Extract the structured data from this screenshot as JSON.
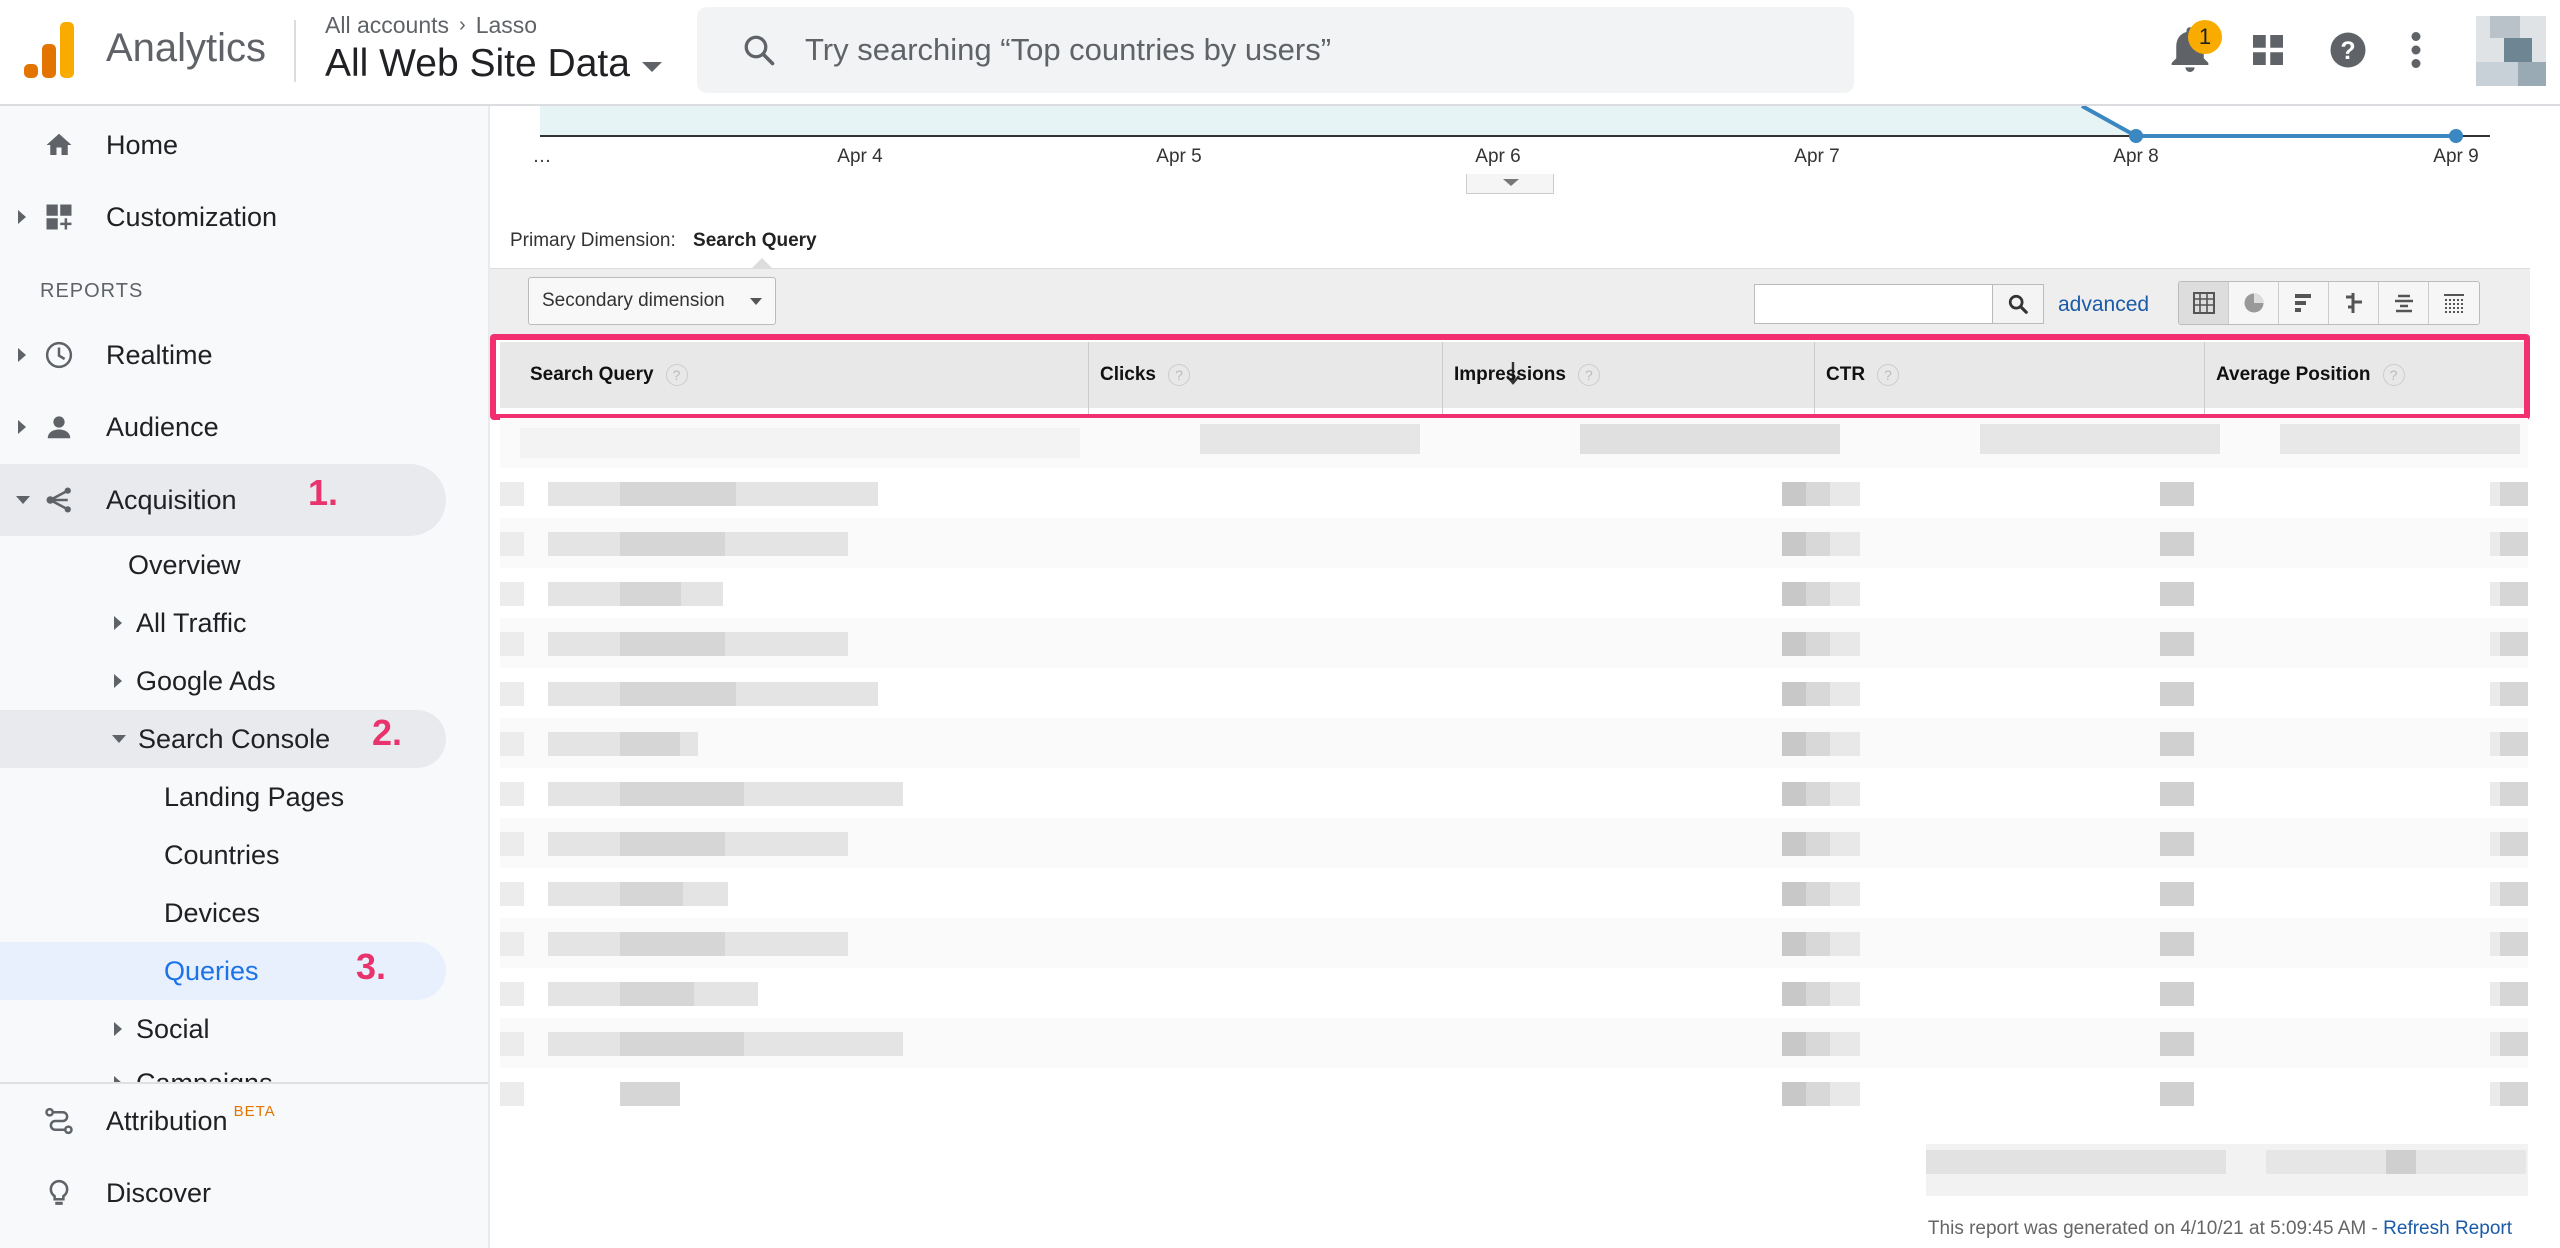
{
  "app": {
    "name": "Analytics"
  },
  "breadcrumb": {
    "account": "All accounts",
    "property": "Lasso"
  },
  "view": {
    "name": "All Web Site Data"
  },
  "search": {
    "placeholder": "Try searching “Top countries by users”"
  },
  "notifications": {
    "count": "1"
  },
  "sidebar": {
    "home": "Home",
    "customization": "Customization",
    "section": "REPORTS",
    "realtime": "Realtime",
    "audience": "Audience",
    "acquisition": "Acquisition",
    "overview": "Overview",
    "all_traffic": "All Traffic",
    "google_ads": "Google Ads",
    "search_console": "Search Console",
    "landing_pages": "Landing Pages",
    "countries": "Countries",
    "devices": "Devices",
    "queries": "Queries",
    "social": "Social",
    "campaigns": "Campaigns",
    "attribution": "Attribution",
    "attribution_badge": "BETA",
    "discover": "Discover"
  },
  "annotations": {
    "step1": "1.",
    "step2": "2.",
    "step3": "3."
  },
  "chart": {
    "x_ticks": [
      "…",
      "Apr 4",
      "Apr 5",
      "Apr 6",
      "Apr 7",
      "Apr 8",
      "Apr 9"
    ]
  },
  "report": {
    "primary_dimension_label": "Primary Dimension:",
    "primary_dimension_value": "Search Query",
    "secondary_dimension": "Secondary dimension",
    "advanced": "advanced",
    "columns": [
      "Search Query",
      "Clicks",
      "Impressions",
      "CTR",
      "Average Position"
    ],
    "help_mark": "?",
    "footer_text": "This report was generated on 4/10/21 at 5:09:45 AM - ",
    "refresh": "Refresh Report"
  },
  "colors": {
    "accent": "#1a73e8",
    "highlight": "#f3306f",
    "logo_orange": "#e37400",
    "logo_yellow": "#f9ab00",
    "active_nav_bg": "#e8f0fe"
  }
}
